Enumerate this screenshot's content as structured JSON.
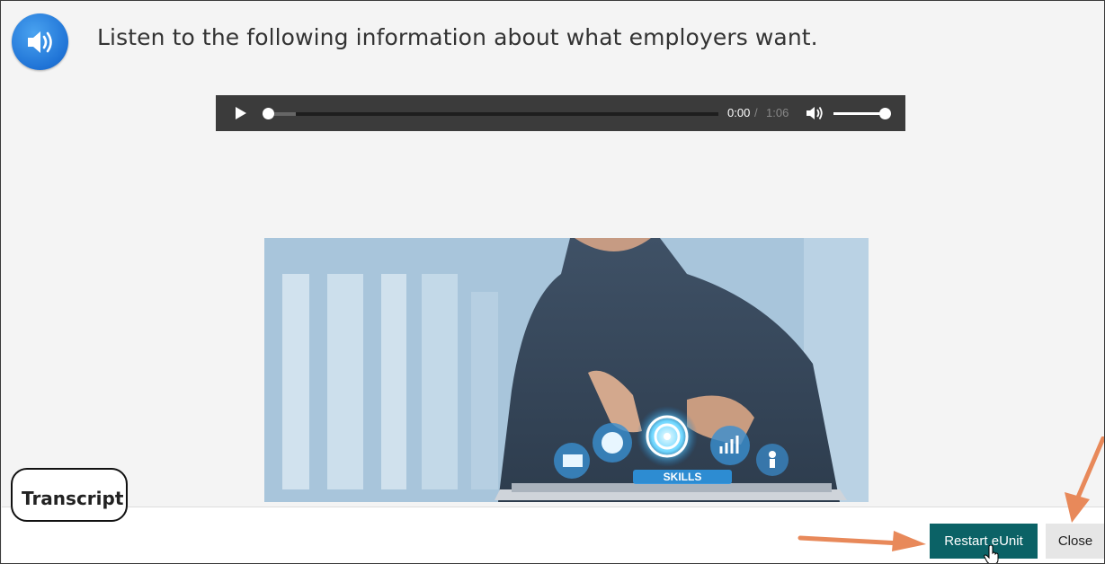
{
  "instruction": {
    "text": "Listen to the following information about what employers want.",
    "icon": "speaker-icon"
  },
  "audio_player": {
    "current_time": "0:00",
    "separator": "/",
    "duration": "1:06",
    "progress_fraction": 0.0,
    "volume_fraction": 1.0,
    "play_icon": "play-icon",
    "volume_icon": "volume-icon"
  },
  "hero_image": {
    "caption": "SKILLS"
  },
  "transcript": {
    "label": "Transcript"
  },
  "footer": {
    "restart_label": "Restart eUnit",
    "close_label": "Close"
  },
  "colors": {
    "accent_teal": "#0b6266",
    "annotation_arrow": "#e8895a",
    "speaker_blue": "#1f73d6",
    "player_bg": "#3b3b3b"
  }
}
